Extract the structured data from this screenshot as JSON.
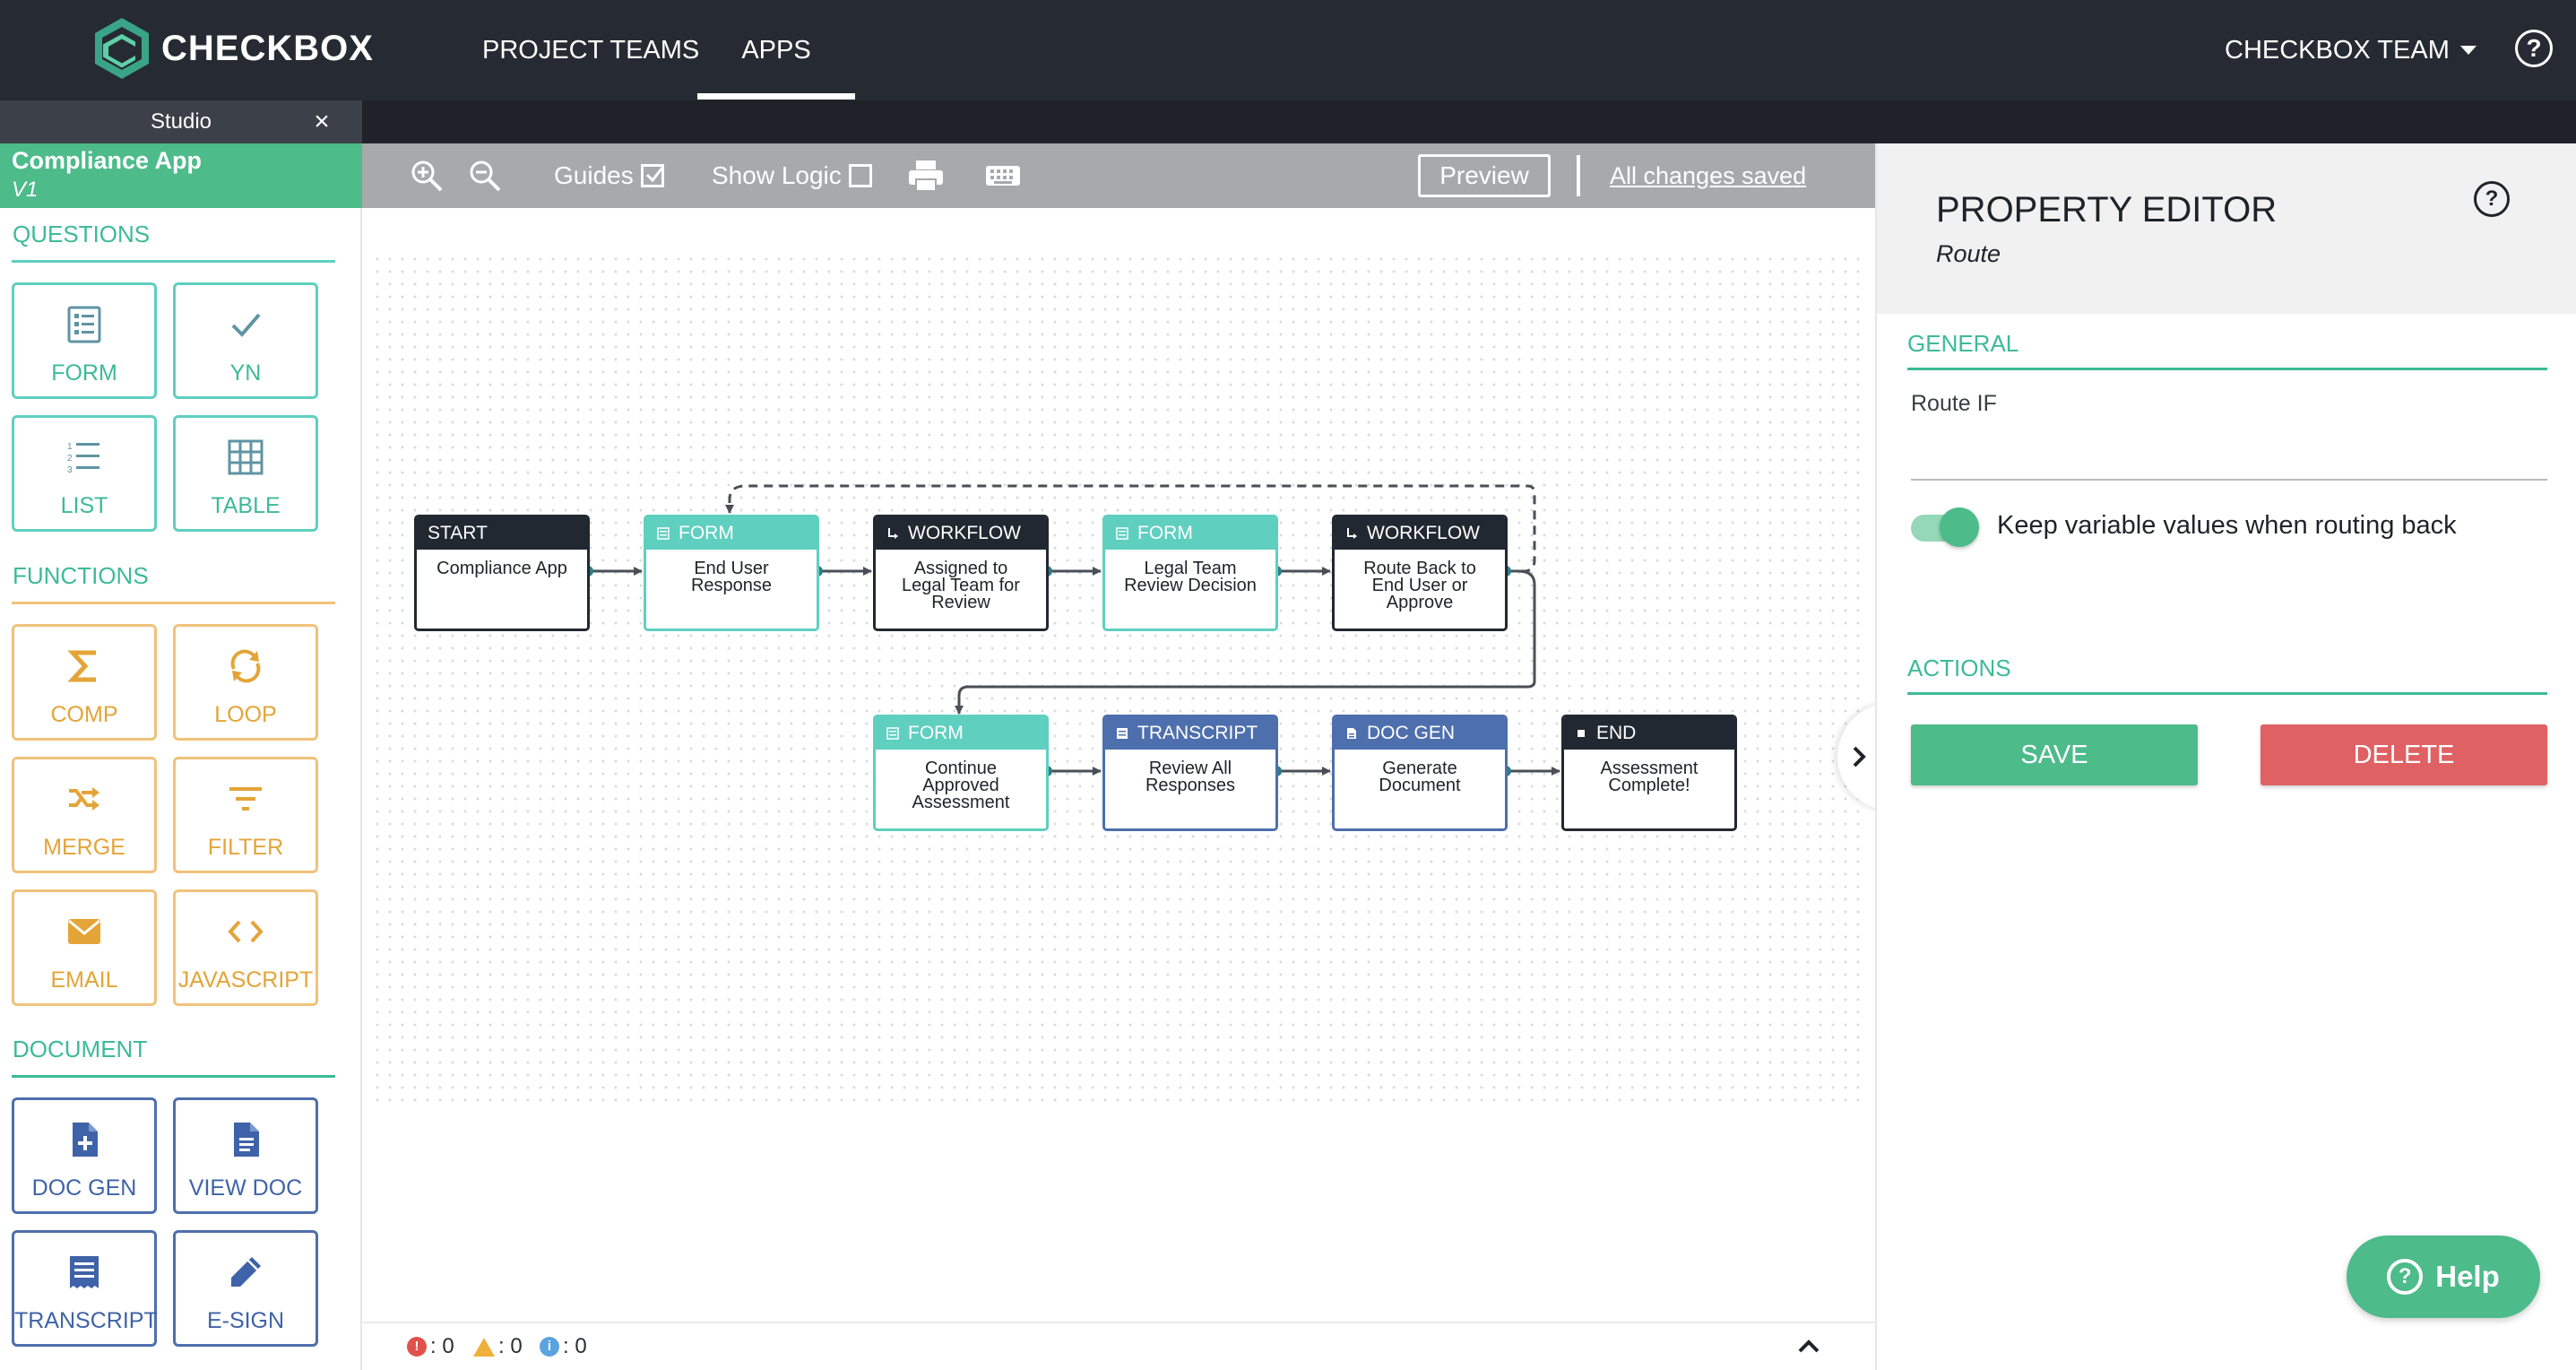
{
  "topnav": {
    "brand": "CHECKBOX",
    "links": [
      "PROJECT TEAMS",
      "APPS"
    ],
    "active_link": "APPS",
    "team_menu": "CHECKBOX TEAM",
    "help_icon": "help-circle-icon",
    "help_glyph": "?"
  },
  "studio": {
    "tab_label": "Studio",
    "close_glyph": "×"
  },
  "sidebar": {
    "app_name": "Compliance App",
    "app_version": "V1",
    "sections": {
      "questions": {
        "title": "QUESTIONS",
        "tiles": [
          {
            "label": "FORM",
            "icon": "form-icon"
          },
          {
            "label": "YN",
            "icon": "checkmark-icon"
          },
          {
            "label": "LIST",
            "icon": "list-icon"
          },
          {
            "label": "TABLE",
            "icon": "table-icon"
          }
        ]
      },
      "functions": {
        "title": "FUNCTIONS",
        "tiles": [
          {
            "label": "COMP",
            "icon": "sigma-icon"
          },
          {
            "label": "LOOP",
            "icon": "loop-icon"
          },
          {
            "label": "MERGE",
            "icon": "merge-icon"
          },
          {
            "label": "FILTER",
            "icon": "filter-icon"
          },
          {
            "label": "EMAIL",
            "icon": "email-icon"
          },
          {
            "label": "JAVASCRIPT",
            "icon": "code-icon"
          }
        ]
      },
      "document": {
        "title": "DOCUMENT",
        "tiles": [
          {
            "label": "DOC GEN",
            "icon": "doc-gen-icon"
          },
          {
            "label": "VIEW DOC",
            "icon": "view-doc-icon"
          },
          {
            "label": "TRANSCRIPT",
            "icon": "transcript-icon"
          },
          {
            "label": "E-SIGN",
            "icon": "pencil-icon"
          }
        ]
      }
    },
    "colors": {
      "questions": "#5fcfc0",
      "functions": "#f0c27a",
      "document": "#4e6fad",
      "header": "#4dbb8a"
    }
  },
  "toolbar": {
    "zoom_in_icon": "zoom-in-icon",
    "zoom_out_icon": "zoom-out-icon",
    "guides_label": "Guides",
    "guides_checked": true,
    "show_logic_label": "Show Logic",
    "show_logic_checked": false,
    "print_icon": "print-icon",
    "keyboard_icon": "keyboard-icon",
    "preview_label": "Preview",
    "save_status": "All changes saved"
  },
  "flow": {
    "nodes": [
      {
        "id": "n1",
        "type": "START",
        "text": "Compliance App",
        "style": "dark"
      },
      {
        "id": "n2",
        "type": "FORM",
        "text": "End User Response",
        "style": "teal"
      },
      {
        "id": "n3",
        "type": "WORKFLOW",
        "text": "Assigned to Legal Team for Review",
        "style": "dark"
      },
      {
        "id": "n4",
        "type": "FORM",
        "text": "Legal Team Review Decision",
        "style": "teal"
      },
      {
        "id": "n5",
        "type": "WORKFLOW",
        "text": "Route Back to End User or Approve",
        "style": "dark"
      },
      {
        "id": "n6",
        "type": "FORM",
        "text": "Continue Approved Assessment",
        "style": "teal"
      },
      {
        "id": "n7",
        "type": "TRANSCRIPT",
        "text": "Review All Responses",
        "style": "blue"
      },
      {
        "id": "n8",
        "type": "DOC GEN",
        "text": "Generate Document",
        "style": "blue"
      },
      {
        "id": "n9",
        "type": "END",
        "text": "Assessment Complete!",
        "style": "dark"
      }
    ],
    "edges": [
      {
        "from": "n1",
        "to": "n2",
        "style": "solid"
      },
      {
        "from": "n2",
        "to": "n3",
        "style": "solid"
      },
      {
        "from": "n3",
        "to": "n4",
        "style": "solid"
      },
      {
        "from": "n4",
        "to": "n5",
        "style": "solid"
      },
      {
        "from": "n5",
        "to": "n2",
        "style": "dashed"
      },
      {
        "from": "n5",
        "to": "n6",
        "style": "solid"
      },
      {
        "from": "n6",
        "to": "n7",
        "style": "solid"
      },
      {
        "from": "n7",
        "to": "n8",
        "style": "solid"
      },
      {
        "from": "n8",
        "to": "n9",
        "style": "solid"
      }
    ]
  },
  "status": {
    "errors": ": 0",
    "warnings": ": 0",
    "info": ": 0",
    "error_icon": "error-icon",
    "warning_icon": "warning-icon",
    "info_icon": "info-icon",
    "error_glyph": "!",
    "info_glyph": "i",
    "expand_icon": "chevron-up-icon"
  },
  "property_editor": {
    "title": "PROPERTY EDITOR",
    "subtitle": "Route",
    "help_glyph": "?",
    "general_title": "GENERAL",
    "route_if_label": "Route IF",
    "route_if_value": "",
    "keep_values_label": "Keep variable values when routing back",
    "keep_values_on": true,
    "actions_title": "ACTIONS",
    "save_label": "SAVE",
    "delete_label": "DELETE"
  },
  "help_fab": {
    "label": "Help",
    "glyph": "?"
  }
}
